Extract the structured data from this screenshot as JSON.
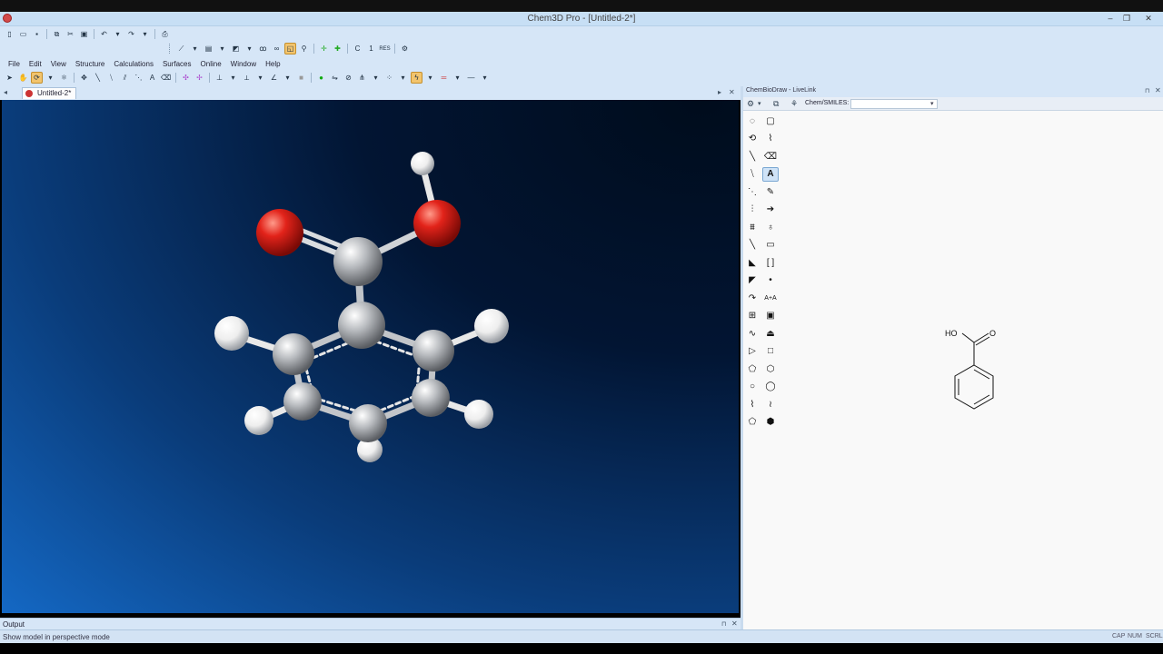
{
  "window": {
    "title": "Chem3D Pro - [Untitled-2*]"
  },
  "menu": [
    "File",
    "Edit",
    "View",
    "Structure",
    "Calculations",
    "Surfaces",
    "Online",
    "Window",
    "Help"
  ],
  "document": {
    "tab_label": "Untitled-2*"
  },
  "output": {
    "label": "Output"
  },
  "status": {
    "message": "Show model in perspective mode",
    "indicators": [
      "CAP",
      "NUM",
      "SCRL"
    ]
  },
  "livelink": {
    "panel_title": "ChemBioDraw - LiveLink",
    "smiles_label": "Chem/SMILES:",
    "smiles_value": ""
  },
  "molecule_2d": {
    "label_oh": "HO",
    "label_o": "O"
  },
  "colors": {
    "accent": "#f2c46d",
    "oxygen": "#e0201a",
    "carbon": "#b9bcc0",
    "hydrogen": "#f2f2f2"
  }
}
